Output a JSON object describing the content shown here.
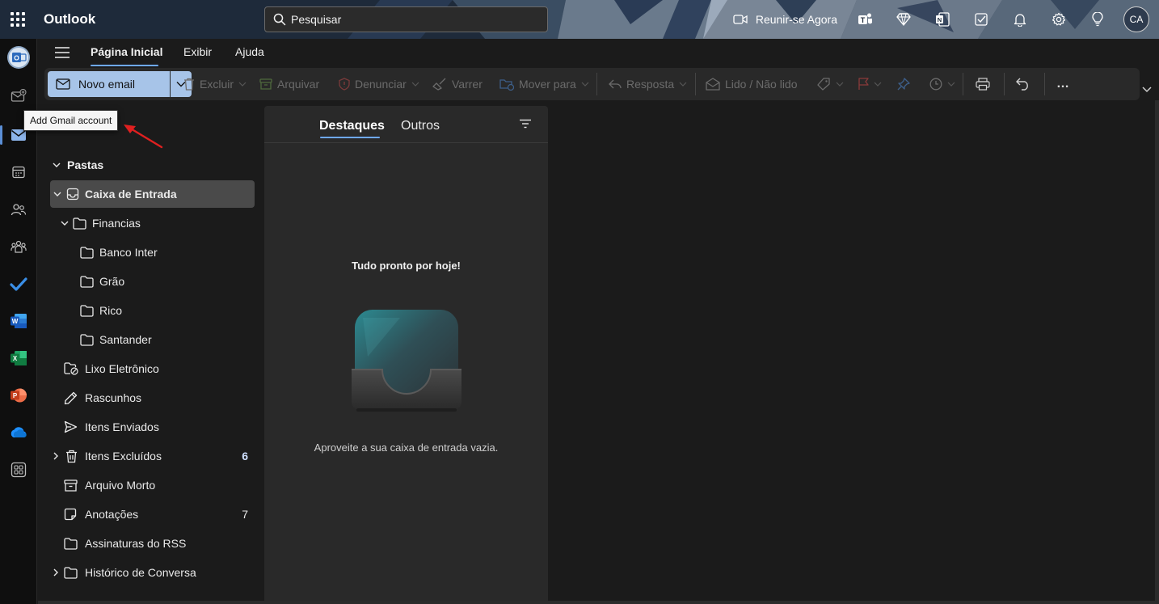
{
  "topbar": {
    "app_name": "Outlook",
    "search_placeholder": "Pesquisar",
    "meet_now_label": "Reunir-se Agora",
    "icons": [
      "video-icon",
      "teams-icon",
      "premium-diamond-icon",
      "onenote-icon",
      "todo-icon",
      "bell-icon",
      "gear-icon",
      "lightbulb-icon"
    ],
    "avatar_initials": "CA"
  },
  "tooltip": {
    "text": "Add Gmail account"
  },
  "menu_tabs": [
    {
      "label": "Página Inicial",
      "active": true
    },
    {
      "label": "Exibir",
      "active": false
    },
    {
      "label": "Ajuda",
      "active": false
    }
  ],
  "ribbon": {
    "new_mail": "Novo email",
    "delete": "Excluir",
    "archive": "Arquivar",
    "report": "Denunciar",
    "sweep": "Varrer",
    "move_to": "Mover para",
    "reply": "Resposta",
    "read_unread": "Lido / Não lido",
    "more": "…"
  },
  "folders": {
    "header": "Pastas",
    "items": [
      {
        "label": "Caixa de Entrada",
        "count": ""
      },
      {
        "label": "Financias",
        "count": ""
      },
      {
        "label": "Banco Inter",
        "count": ""
      },
      {
        "label": "Grão",
        "count": ""
      },
      {
        "label": "Rico",
        "count": ""
      },
      {
        "label": "Santander",
        "count": ""
      },
      {
        "label": "Lixo Eletrônico",
        "count": ""
      },
      {
        "label": "Rascunhos",
        "count": ""
      },
      {
        "label": "Itens Enviados",
        "count": ""
      },
      {
        "label": "Itens Excluídos",
        "count": "6"
      },
      {
        "label": "Arquivo Morto",
        "count": ""
      },
      {
        "label": "Anotações",
        "count": "7"
      },
      {
        "label": "Assinaturas do RSS",
        "count": ""
      },
      {
        "label": "Histórico de Conversa",
        "count": ""
      }
    ]
  },
  "message_list": {
    "tabs": [
      "Destaques",
      "Outros"
    ],
    "empty_title": "Tudo pronto por hoje!",
    "empty_subtitle": "Aproveite a sua caixa de entrada vazia."
  },
  "colors": {
    "accent": "#6ea8ff",
    "new_mail_button": "#a7c4e8",
    "tooltip_arrow": "#e02020"
  }
}
